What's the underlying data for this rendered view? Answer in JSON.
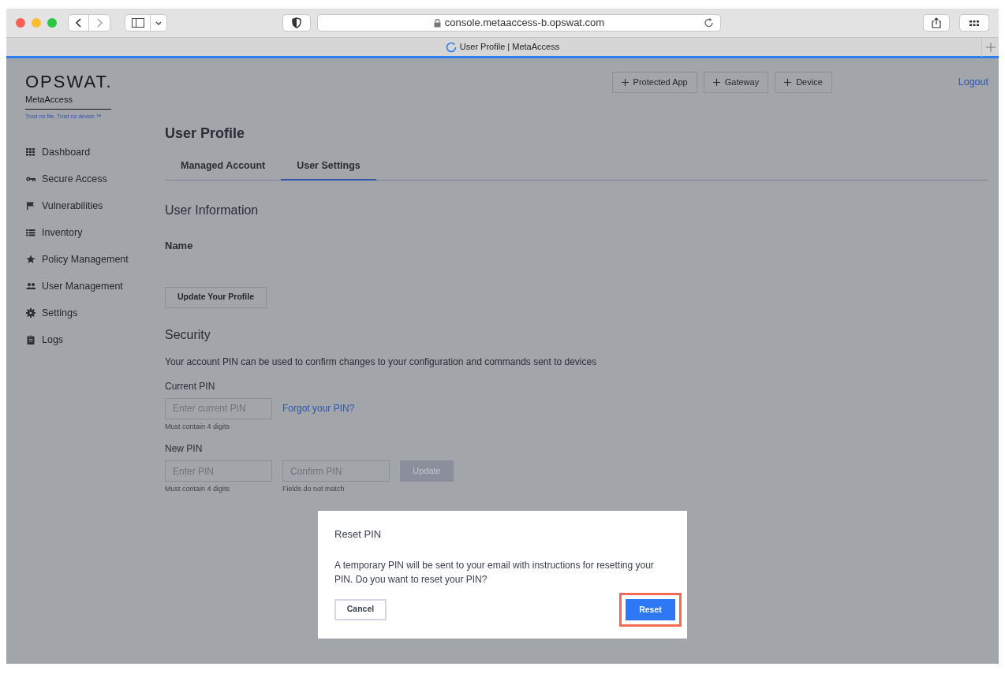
{
  "browser": {
    "url": "console.metaaccess-b.opswat.com",
    "tab_title": "User Profile | MetaAccess",
    "loading": true
  },
  "sidebar": {
    "logo": "OPSWAT.",
    "product": "MetaAccess",
    "tagline": "Trust no file. Trust no device.™",
    "items": [
      {
        "label": "Dashboard",
        "kind": "grid"
      },
      {
        "label": "Secure Access",
        "kind": "key"
      },
      {
        "label": "Vulnerabilities",
        "kind": "flag"
      },
      {
        "label": "Inventory",
        "kind": "list"
      },
      {
        "label": "Policy Management",
        "kind": "star"
      },
      {
        "label": "User Management",
        "kind": "users"
      },
      {
        "label": "Settings",
        "kind": "gear"
      },
      {
        "label": "Logs",
        "kind": "clipboard"
      }
    ]
  },
  "header": {
    "buttons": [
      "Protected App",
      "Gateway",
      "Device"
    ],
    "logout": "Logout"
  },
  "page": {
    "title": "User Profile",
    "tabs": [
      {
        "label": "Managed Account",
        "selected": false
      },
      {
        "label": "User Settings",
        "selected": true
      }
    ],
    "user_information": {
      "heading": "User Information",
      "name_label": "Name",
      "update_button": "Update Your Profile"
    },
    "security": {
      "heading": "Security",
      "description": "Your account PIN can be used to confirm changes to your configuration and commands sent to devices",
      "current_pin": {
        "label": "Current PIN",
        "placeholder": "Enter current PIN",
        "hint": "Must contain 4 digits",
        "link": "Forgot your PIN?"
      },
      "new_pin": {
        "label": "New PIN",
        "placeholder": "Enter PIN",
        "hint": "Must contain 4 digits"
      },
      "confirm_pin": {
        "placeholder": "Confirm PIN",
        "hint": "Fields do not match"
      },
      "update_button": {
        "label": "Update",
        "disabled": true
      }
    }
  },
  "dialog": {
    "title": "Reset PIN",
    "message": "A temporary PIN will be sent to your email with instructions for resetting your PIN. Do you want to reset your PIN?",
    "cancel": "Cancel",
    "confirm": "Reset",
    "confirm_highlighted": true
  }
}
